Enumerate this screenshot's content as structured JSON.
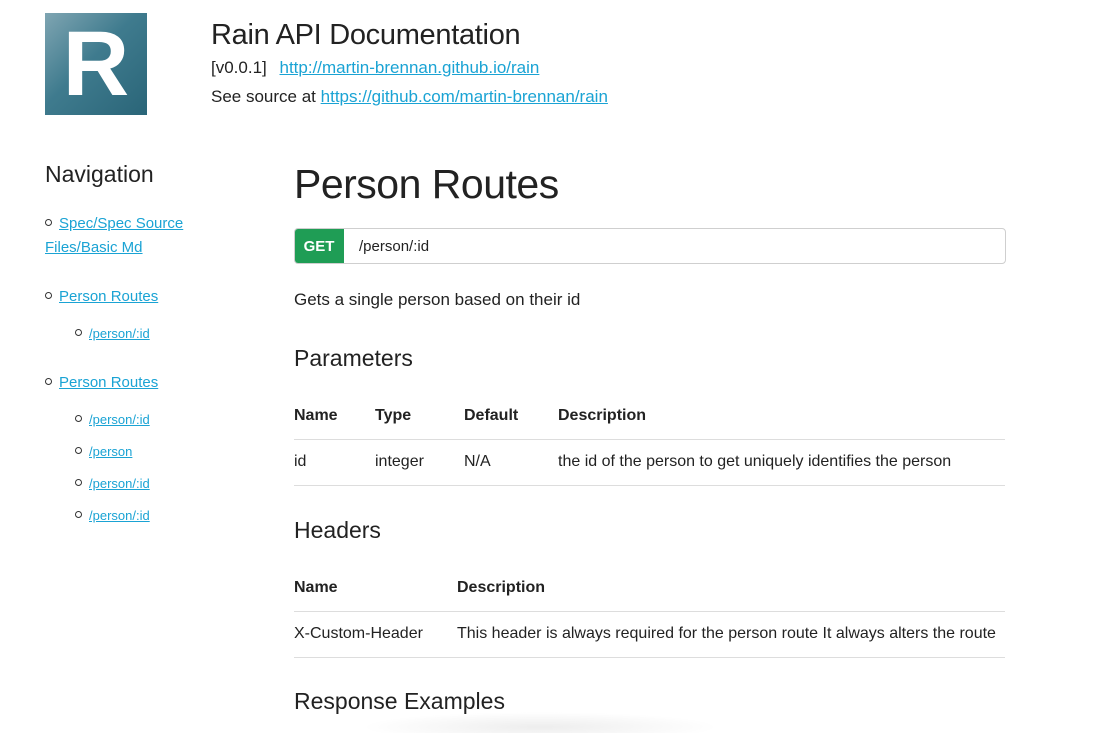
{
  "logo": {
    "letter": "R"
  },
  "header": {
    "title": "Rain API Documentation",
    "version": "[v0.0.1]",
    "site_link": "http://martin-brennan.github.io/rain",
    "source_prefix": "See source at",
    "source_link": "https://github.com/martin-brennan/rain"
  },
  "nav": {
    "title": "Navigation",
    "items": [
      {
        "label": "Spec/Spec Source Files/Basic Md",
        "children": []
      },
      {
        "label": "Person Routes",
        "children": [
          "/person/:id"
        ]
      },
      {
        "label": "Person Routes",
        "children": [
          "/person/:id",
          "/person",
          "/person/:id",
          "/person/:id"
        ]
      }
    ]
  },
  "main": {
    "title": "Person Routes",
    "method": "GET",
    "path": "/person/:id",
    "description": "Gets a single person based on their id",
    "parameters": {
      "heading": "Parameters",
      "columns": [
        "Name",
        "Type",
        "Default",
        "Description"
      ],
      "rows": [
        [
          "id",
          "integer",
          "N/A",
          "the id of the person to get uniquely identifies the person"
        ]
      ]
    },
    "headers": {
      "heading": "Headers",
      "columns": [
        "Name",
        "Description"
      ],
      "rows": [
        [
          "X-Custom-Header",
          "This header is always required for the person route It always alters the route"
        ]
      ]
    },
    "response_heading": "Response Examples"
  },
  "colors": {
    "link": "#1aa3d4",
    "get_badge": "#1f9d55",
    "logo": "#3f7b8e"
  }
}
